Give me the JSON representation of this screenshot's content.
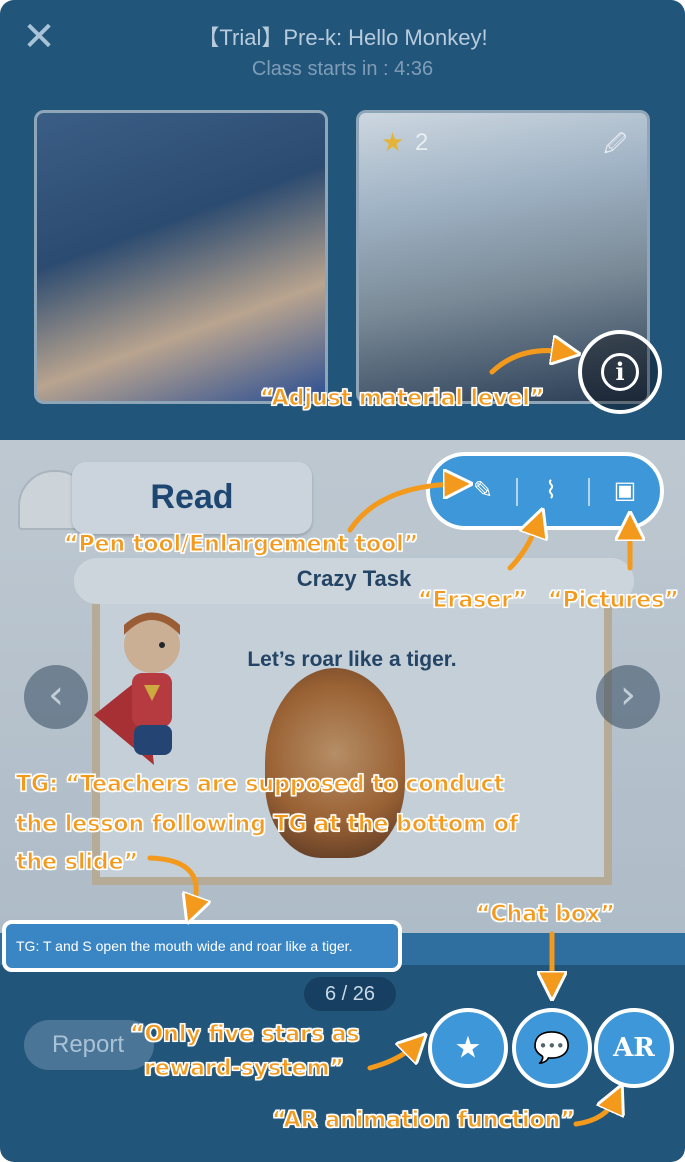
{
  "header": {
    "close_icon": "close-icon",
    "title": "【Trial】Pre-k: Hello Monkey!",
    "countdown": "Class starts in : 4:36"
  },
  "student_video": {
    "star_count": "2",
    "star_icon": "star-icon",
    "mic_icon": "mic-muted-icon",
    "info_icon": "info-icon"
  },
  "slide": {
    "banner": "Read",
    "board_title": "Crazy Task",
    "prompt": "Let’s roar like a tiger.",
    "prev_icon": "chevron-left-icon",
    "next_icon": "chevron-right-icon"
  },
  "toolbar": {
    "pen_icon": "pencil-icon",
    "eraser_icon": "broom-icon",
    "pictures_icon": "image-icon"
  },
  "tg": {
    "text": "TG: T and S open the mouth wide and roar like a tiger."
  },
  "pager": "6 / 26",
  "bottom": {
    "report": "Report",
    "star_reward_icon": "star-reward-icon",
    "chat_icon": "chat-icon",
    "ar_label": "AR"
  },
  "annotations": {
    "adjust": "“Adjust material level”",
    "pen": "“Pen tool/Enlargement tool”",
    "eraser": "“Eraser”",
    "pictures": "“Pictures”",
    "tg_line1": "TG: “Teachers are supposed to conduct",
    "tg_line2": "the lesson following TG at the bottom of",
    "tg_line3": "the slide”",
    "chat": "“Chat box”",
    "stars_line1": "“Only five stars as",
    "stars_line2": "reward-system”",
    "ar": "“AR animation function”"
  },
  "colors": {
    "background": "#22557a",
    "accent": "#3d97d8",
    "annotation": "#f39a1c"
  }
}
